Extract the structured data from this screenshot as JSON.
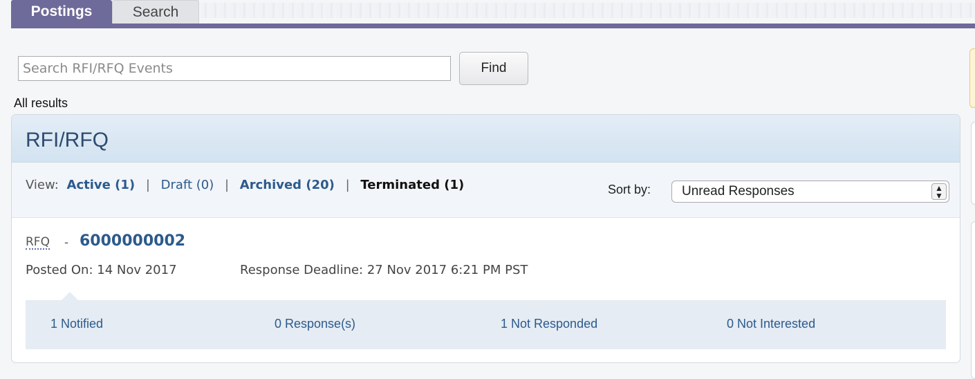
{
  "tabs": [
    {
      "label": "Postings",
      "active": true
    },
    {
      "label": "Search",
      "active": false
    }
  ],
  "search": {
    "placeholder": "Search RFI/RFQ Events",
    "value": "",
    "button_label": "Find"
  },
  "results_label": "All results",
  "panel": {
    "title": "RFI/RFQ",
    "view_label": "View:",
    "view_options": [
      {
        "label": "Active (1)",
        "style": "link-bold"
      },
      {
        "label": "Draft (0)",
        "style": "link"
      },
      {
        "label": "Archived (20)",
        "style": "link-bold"
      },
      {
        "label": "Terminated (1)",
        "style": "selected"
      }
    ],
    "sort_label": "Sort by:",
    "sort_selected": "Unread Responses",
    "sort_icon": "updown-arrows-icon"
  },
  "item": {
    "type": "RFQ",
    "separator": "-",
    "id": "6000000002",
    "posted_on": "Posted On: 14 Nov 2017",
    "deadline": "Response Deadline: 27 Nov 2017 6:21 PM PST",
    "stats": [
      "1 Notified",
      "0 Response(s)",
      "1 Not Responded",
      "0 Not Interested"
    ]
  },
  "colors": {
    "tab_active": "#6e6a99",
    "link": "#2c5a8c",
    "header_bg": "#dbe8f4"
  }
}
